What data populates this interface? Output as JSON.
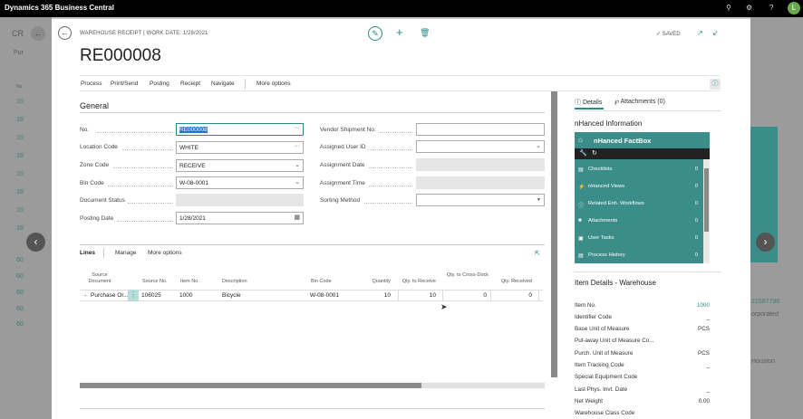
{
  "topbar": {
    "brand": "Dynamics 365 Business Central",
    "avatar_letter": "L"
  },
  "background": {
    "left_texts": [
      "CR",
      "Pur",
      "10",
      "10",
      "10",
      "10",
      "10",
      "10",
      "10",
      "10",
      "60",
      "60",
      "60",
      "60",
      "60"
    ],
    "right_texts": [
      "Houston"
    ],
    "right_teal": "21587796",
    "right_sub": "orporated"
  },
  "dialog": {
    "caption": "WAREHOUSE RECEIPT | WORK DATE: 1/28/2021",
    "title": "RE000008",
    "saved_label": "SAVED",
    "actions": [
      "Process",
      "Print/Send",
      "Posting",
      "Receipt",
      "Navigate"
    ],
    "more_options": "More options"
  },
  "general": {
    "title": "General",
    "left_fields": [
      {
        "label": "No.",
        "value": "RE000008",
        "icon": "ellipsis"
      },
      {
        "label": "Location Code",
        "value": "WHITE",
        "icon": "ellipsis"
      },
      {
        "label": "Zone Code",
        "value": "RECEIVE",
        "icon": "chevron-down"
      },
      {
        "label": "Bin Code",
        "value": "W-08-0001",
        "icon": "chevron-down"
      },
      {
        "label": "Document Status",
        "value": "",
        "icon": ""
      },
      {
        "label": "Posting Date",
        "value": "1/28/2021",
        "icon": "calendar"
      }
    ],
    "right_fields": [
      {
        "label": "Vendor Shipment No.",
        "value": ""
      },
      {
        "label": "Assigned User ID",
        "value": ""
      },
      {
        "label": "Assignment Date",
        "value": ""
      },
      {
        "label": "Assignment Time",
        "value": ""
      },
      {
        "label": "Sorting Method",
        "value": ""
      }
    ]
  },
  "lines": {
    "tab_lines": "Lines",
    "tab_manage": "Manage",
    "tab_more": "More options",
    "headers": [
      "Source Document",
      "Source No.",
      "Item No.",
      "Description",
      "Bin Code",
      "Quantity",
      "Qty. to Receive",
      "Qty. to Cross-Dock",
      "Qty. Received"
    ],
    "rows": [
      {
        "source_document": "Purchase Or...",
        "source_no": "106025",
        "item_no": "1000",
        "description": "Bicycle",
        "bin_code": "W-08-0001",
        "quantity": "10",
        "qty_to_receive": "10",
        "qty_to_cross_dock": "0",
        "qty_received": "0"
      }
    ]
  },
  "factbox": {
    "tab_details": "Details",
    "tab_attachments": "Attachments (0)",
    "nhanced_title": "nHanced Information",
    "nhanced_box_title": "nHanced FactBox",
    "nhanced_items": [
      {
        "label": "Checklists",
        "count": "0"
      },
      {
        "label": "nHanced Views",
        "count": "0"
      },
      {
        "label": "Related Enh. Workflows",
        "count": "0"
      },
      {
        "label": "Attachments",
        "count": "0"
      },
      {
        "label": "User Tasks",
        "count": "0"
      },
      {
        "label": "Process History",
        "count": "0"
      }
    ],
    "item_details_title": "Item Details - Warehouse",
    "item_details": [
      {
        "label": "Item No.",
        "value": "1000"
      },
      {
        "label": "Identifier Code",
        "value": "_"
      },
      {
        "label": "Base Unit of Measure",
        "value": "PCS"
      },
      {
        "label": "Put-away Unit of Measure Co...",
        "value": ""
      },
      {
        "label": "Purch. Unit of Measure",
        "value": "PCS"
      },
      {
        "label": "Item Tracking Code",
        "value": "_"
      },
      {
        "label": "Special Equipment Code",
        "value": ""
      },
      {
        "label": "Last Phys. Invt. Date",
        "value": "_"
      },
      {
        "label": "Net Weight",
        "value": "0.00"
      },
      {
        "label": "Warehouse Class Code",
        "value": ""
      }
    ]
  },
  "colors": {
    "accent": "#2b8a87",
    "topbar": "#000000",
    "nhanced": "#3b8d89"
  }
}
